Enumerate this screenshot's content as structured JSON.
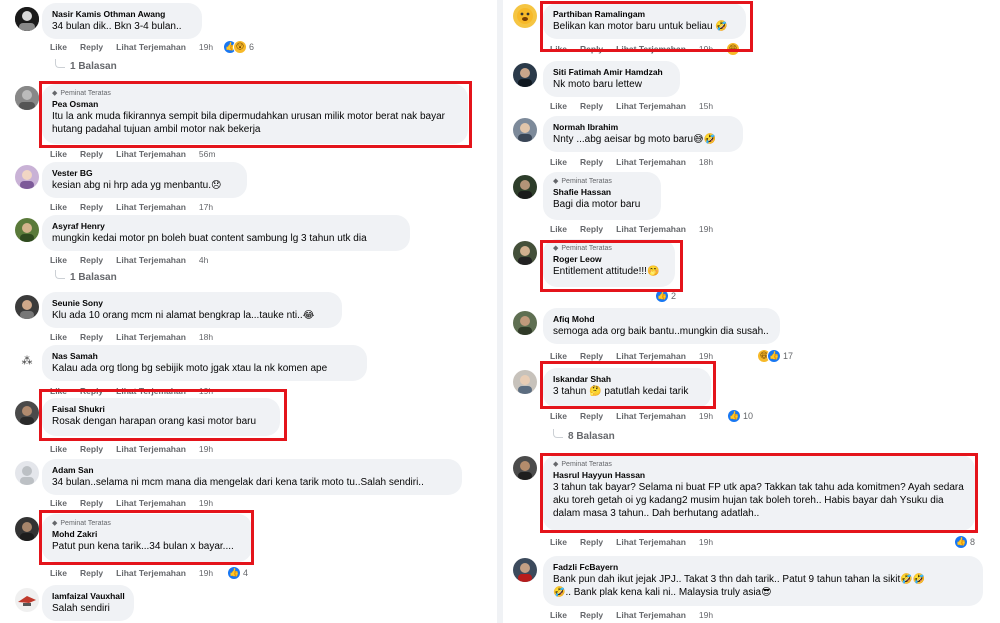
{
  "labels": {
    "like": "Like",
    "reply": "Reply",
    "translate": "Lihat Terjemahan"
  },
  "badge": "Peminat Teratas",
  "left": [
    {
      "name": "Nasir Kamis Othman Awang",
      "text": "34 bulan dik.. Bkn 3-4 bulan..",
      "time": "19h",
      "reactions": "6",
      "replies": "1 Balasan"
    },
    {
      "name": "Pea Osman",
      "text": "Itu la ank muda fikirannya sempit bila dipermudahkan urusan milik motor berat nak bayar hutang padahal tujuan ambil motor nak bekerja",
      "time": "56m",
      "badge": true
    },
    {
      "name": "Vester BG",
      "text": "kesian abg ni hrp ada yg menbantu.",
      "emoji": "😞",
      "time": "17h"
    },
    {
      "name": "Asyraf Henry",
      "text": "mungkin kedai motor pn boleh buat content sambung lg 3 tahun utk dia",
      "time": "4h",
      "replies": "1 Balasan"
    },
    {
      "name": "Seunie Sony",
      "text": "Klu ada 10 orang mcm ni alamat bengkrap la...tauke nti..",
      "emoji": "😂",
      "time": "18h"
    },
    {
      "name": "Nas Samah",
      "text": "Kalau ada org tlong bg sebijik moto jgak xtau la nk komen ape",
      "time": "19h"
    },
    {
      "name": "Faisal Shukri",
      "text": "Rosak dengan harapan orang kasi motor baru",
      "time": "19h"
    },
    {
      "name": "Adam San",
      "text": "34 bulan..selama ni mcm mana dia mengelak dari kena tarik moto tu..Salah sendiri..",
      "time": "19h"
    },
    {
      "name": "Mohd Zakri",
      "text": "Patut pun kena tarik...34 bulan x bayar....",
      "time": "19h",
      "reactions": "4",
      "badge": true
    },
    {
      "name": "Iamfaizal Vauxhall",
      "text": "Salah sendiri"
    }
  ],
  "right": [
    {
      "name": "Parthiban Ramalingam",
      "text": "Belikan kan motor baru untuk beliau",
      "emoji": "🤣",
      "time": "19h"
    },
    {
      "name": "Siti Fatimah Amir Hamdzah",
      "text": "Nk moto baru lettew",
      "time": "15h"
    },
    {
      "name": "Normah Ibrahim",
      "text": "Nnty ...abg aeisar bg moto baru",
      "emoji": "😅🤣",
      "time": "18h"
    },
    {
      "name": "Shafie Hassan",
      "text": "Bagi dia motor baru",
      "time": "19h",
      "badge": true
    },
    {
      "name": "Roger Leow",
      "text": "Entitlement attitude!!!",
      "emoji": "🤭",
      "reactions": "2",
      "badge": true
    },
    {
      "name": "Afiq Mohd",
      "text": "semoga ada org baik bantu..mungkin dia susah..",
      "time": "19h",
      "reactions": "17"
    },
    {
      "name": "Iskandar Shah",
      "text_a": "3 tahun",
      "emoji": "🤔",
      "text_b": "patutlah kedai tarik",
      "time": "19h",
      "reactions": "10",
      "replies": "8 Balasan"
    },
    {
      "name": "Hasrul Hayyun Hassan",
      "text": "3 tahun tak bayar? Selama ni buat FP utk apa? Takkan tak tahu ada komitmen? Ayah sedara aku toreh getah oi yg kadang2 musim hujan tak boleh toreh.. Habis bayar dah Ysuku dia dalam masa 3 tahun.. Dah berhutang adatlah..",
      "time": "19h",
      "reactions": "8",
      "badge": true
    },
    {
      "name": "Fadzli FcBayern",
      "text_a": "Bank pun dah ikut jejak JPJ.. Takat 3 thn dah tarik.. Patut 9 tahun tahan la sikit",
      "emoji_a": "🤣🤣",
      "text_b": ".. Bank plak kena kali ni.. Malaysia truly asia",
      "emoji_b": "😎",
      "lead_emoji": "🤣",
      "time": "19h"
    }
  ],
  "colors": {
    "highlight": "#e4141b",
    "like": "#1877f2",
    "bubble": "#f0f2f5",
    "meta": "#65676b"
  }
}
